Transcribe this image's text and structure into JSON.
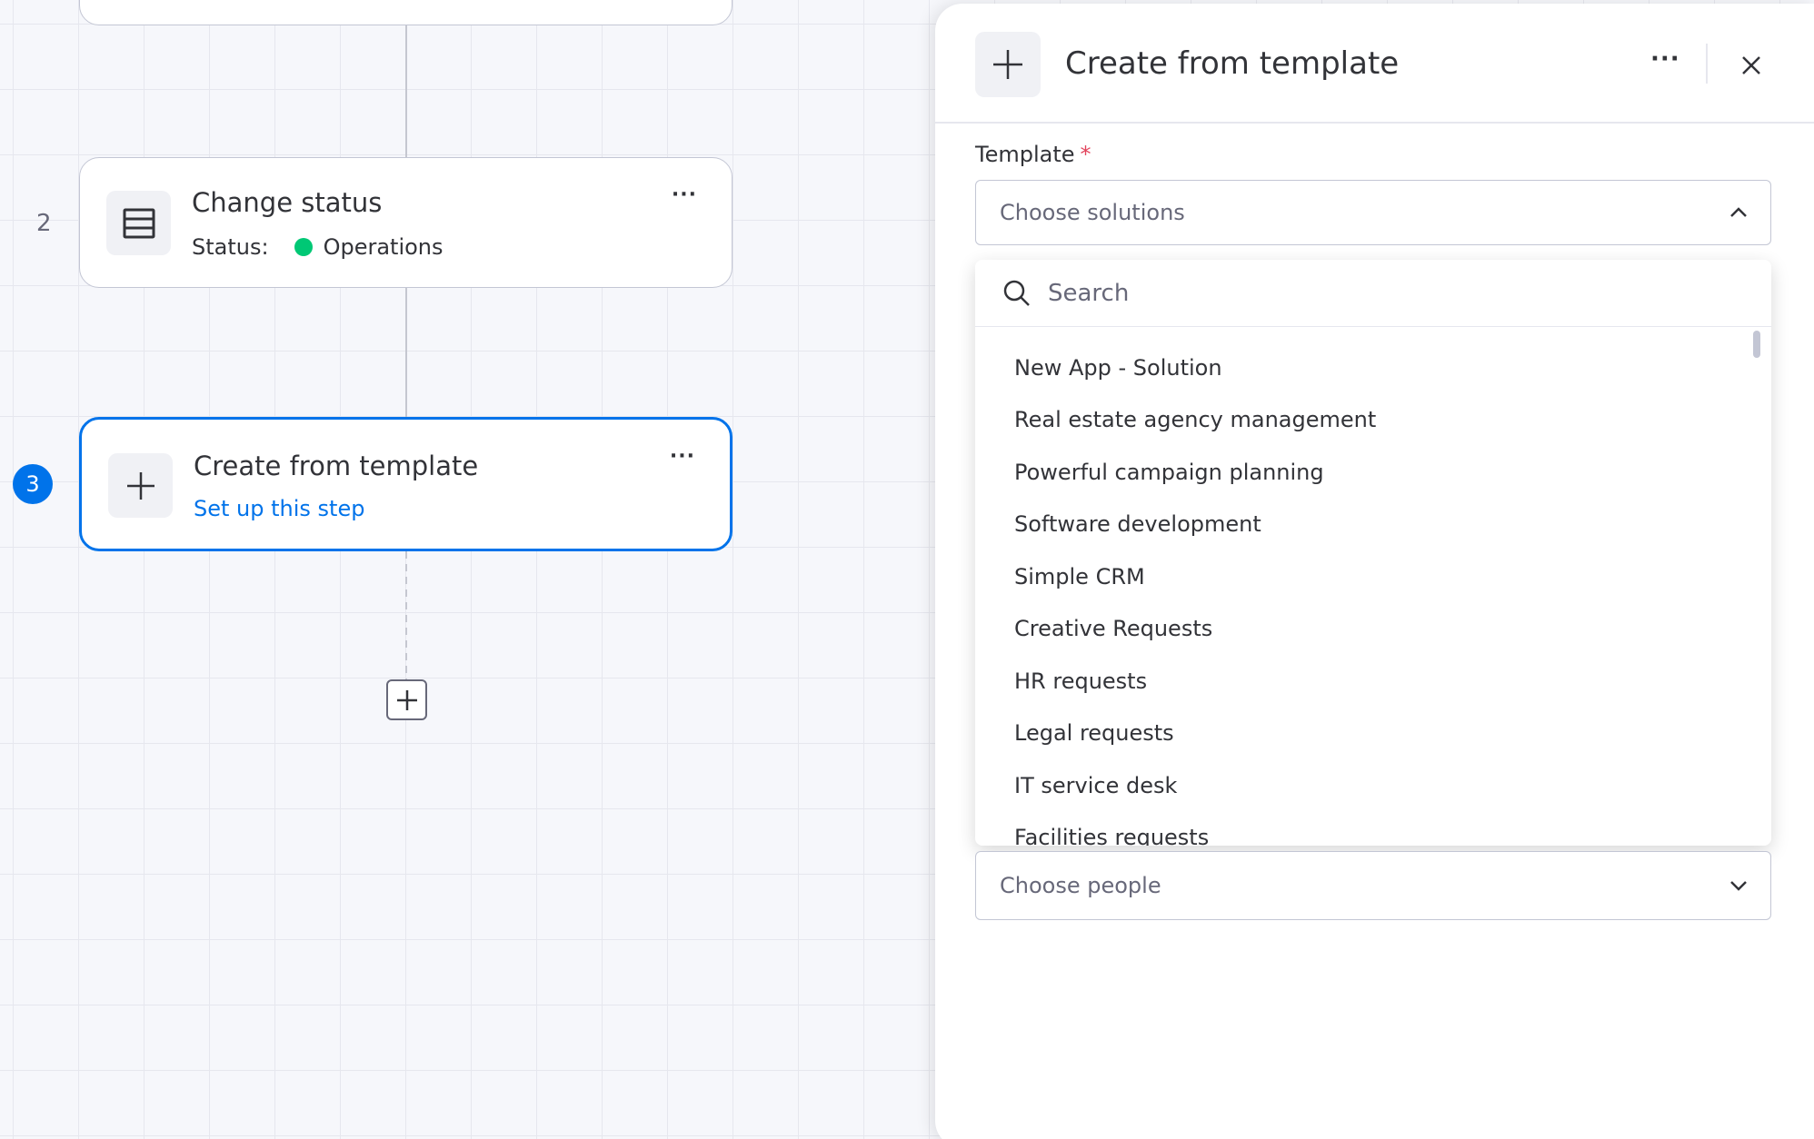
{
  "canvas": {
    "step2": {
      "number": "2",
      "title": "Change status",
      "status_label": "Status:",
      "status_value": "Operations",
      "more": "···"
    },
    "step3": {
      "number": "3",
      "title": "Create from template",
      "subtitle": "Set up this step",
      "more": "···"
    }
  },
  "panel": {
    "title": "Create from template",
    "more": "···",
    "template_label": "Template",
    "required_mark": "*",
    "template_placeholder": "Choose solutions",
    "search_placeholder": "Search",
    "options": [
      "New App - Solution",
      "Real estate agency management",
      "Powerful campaign planning",
      "Software development",
      "Simple CRM",
      "Creative Requests",
      "HR requests",
      "Legal requests",
      "IT service desk",
      "Facilities requests"
    ],
    "people_placeholder": "Choose people"
  },
  "colors": {
    "accent": "#0073ea",
    "status_green": "#00c875",
    "required_red": "#e2445c"
  }
}
